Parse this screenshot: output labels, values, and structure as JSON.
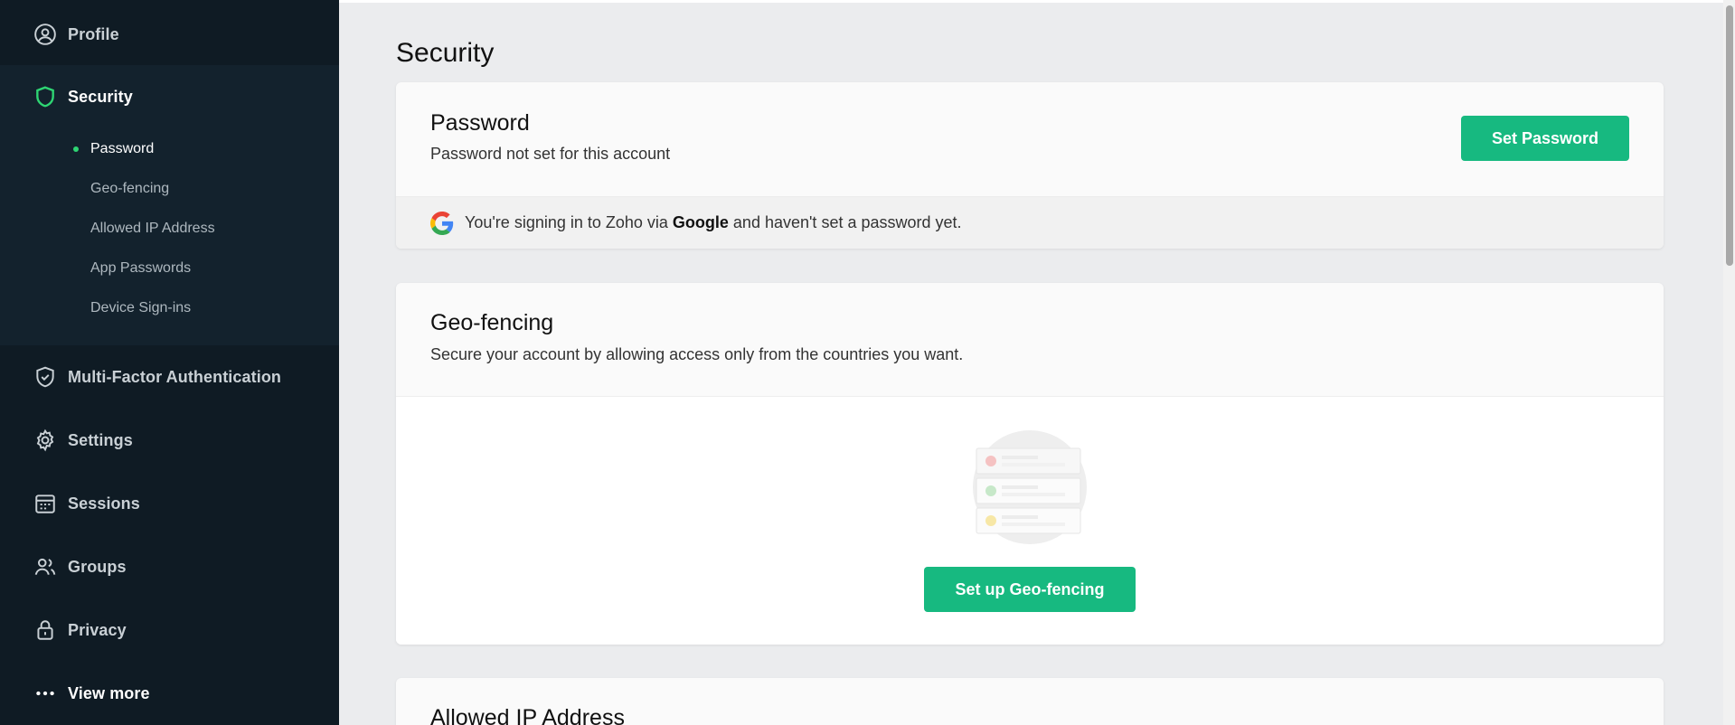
{
  "sidebar": {
    "profile": "Profile",
    "security": "Security",
    "security_items": [
      "Password",
      "Geo-fencing",
      "Allowed IP Address",
      "App Passwords",
      "Device Sign-ins"
    ],
    "mfa": "Multi-Factor Authentication",
    "settings": "Settings",
    "sessions": "Sessions",
    "groups": "Groups",
    "privacy": "Privacy",
    "view_more": "View more"
  },
  "main": {
    "title": "Security",
    "password_card": {
      "title": "Password",
      "subtitle": "Password not set for this account",
      "button": "Set Password",
      "notice_prefix": "You're signing in to Zoho via ",
      "notice_brand": "Google",
      "notice_suffix": " and haven't set a password yet."
    },
    "geo_card": {
      "title": "Geo-fencing",
      "subtitle": "Secure your account by allowing access only from the countries you want.",
      "button": "Set up Geo-fencing"
    },
    "ip_card": {
      "title": "Allowed IP Address"
    }
  },
  "colors": {
    "sidebar_bg": "#0f1b24",
    "accent_green": "#17b980",
    "active_dot": "#2ed573"
  }
}
